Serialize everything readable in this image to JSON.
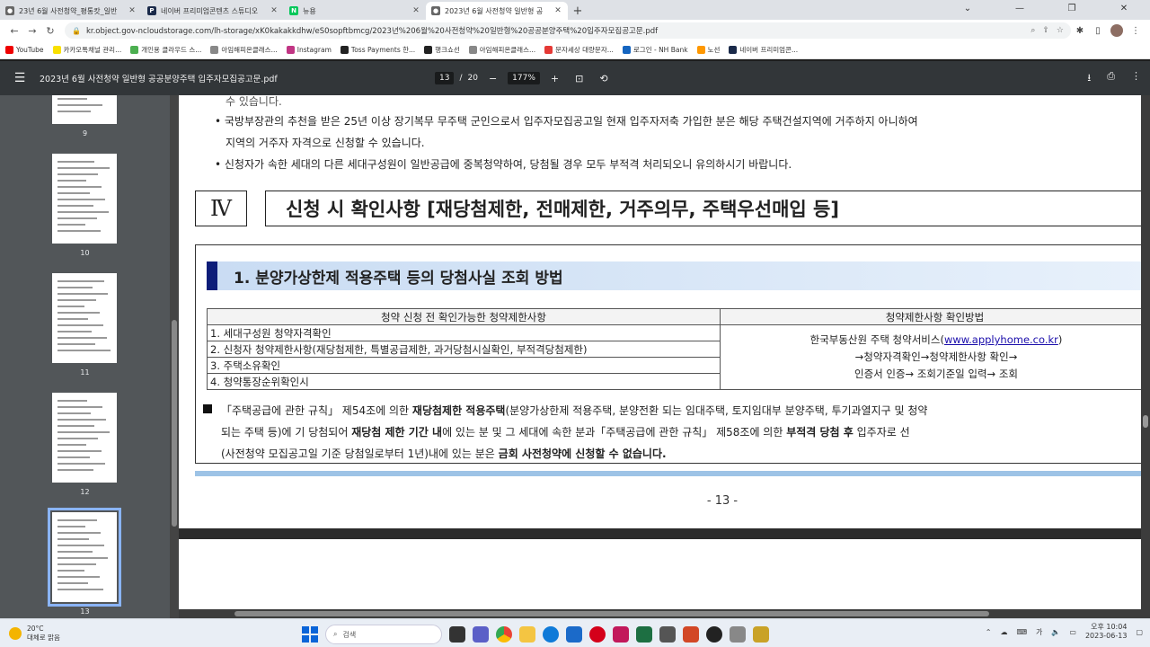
{
  "browser": {
    "tabs": [
      {
        "title": "23년 6월 사전청약_평통캇_일반",
        "color": "#555"
      },
      {
        "title": "네이버 프리미엄콘텐츠 스튜디오",
        "color": "#1a2a4a"
      },
      {
        "title": "뉴용",
        "color": "#03c75a"
      },
      {
        "title": "2023년 6월 사전청약 일반형 공",
        "color": "#555"
      }
    ],
    "url": "kr.object.gov-ncloudstorage.com/lh-storage/xK0kakakkdhw/eS0sopftbmcg/2023년%206월%20사전청약%20일반형%20공공분양주택%20입주자모집공고문.pdf",
    "bookmarks": [
      {
        "label": "YouTube",
        "color": "#e00"
      },
      {
        "label": "카카오톡채널 관리...",
        "color": "#f9e000"
      },
      {
        "label": "개인용 클라우드 스...",
        "color": "#4caf50"
      },
      {
        "label": "아임해피온클래스...",
        "color": "#888"
      },
      {
        "label": "Instagram",
        "color": "#c13584"
      },
      {
        "label": "Toss Payments 한...",
        "color": "#222"
      },
      {
        "label": "행크쇼선",
        "color": "#222"
      },
      {
        "label": "아임해피온클래스...",
        "color": "#888"
      },
      {
        "label": "문자세상 대량문자...",
        "color": "#e53935"
      },
      {
        "label": "로그인 - NH Bank",
        "color": "#1565c0"
      },
      {
        "label": "노선",
        "color": "#ff9800"
      },
      {
        "label": "네이버 프리미엄콘...",
        "color": "#1a2a4a"
      }
    ]
  },
  "pdf": {
    "title": "2023년 6월 사전청약 일반형 공공분양주택 입주자모집공고문.pdf",
    "page_current": "13",
    "page_sep": "/",
    "page_total": "20",
    "zoom": "177%",
    "thumbnails": [
      {
        "num": "9"
      },
      {
        "num": "10"
      },
      {
        "num": "11"
      },
      {
        "num": "12"
      },
      {
        "num": "13"
      }
    ],
    "top_text": {
      "line0": "수 있습니다.",
      "bullet1a": "• 국방부장관의 추천을 받은 25년 이상 장기복무 무주택 군인으로서 입주자모집공고일 현재 입주자저축 가입한 분은 해당 주택건설지역에 거주하지 아니하여",
      "bullet1b": "지역의 거주자 자격으로 신청할 수 있습니다.",
      "bullet2": "• 신청자가 속한 세대의 다른 세대구성원이 일반공급에 중복청약하여, 당첨될 경우 모두 부적격 처리되오니 유의하시기 바랍니다."
    },
    "section": {
      "roman": "Ⅳ",
      "title": "신청 시 확인사항 [재당첨제한, 전매제한, 거주의무, 주택우선매입 등]"
    },
    "subsection": {
      "title": "1. 분양가상한제 적용주택 등의 당첨사실 조회 방법",
      "table": {
        "headers": [
          "청약 신청 전 확인가능한 청약제한사항",
          "청약제한사항 확인방법"
        ],
        "rows": [
          "1. 세대구성원 청약자격확인",
          "2. 신청자 청약제한사항(재당첨제한, 특별공급제한, 과거당첨시실확인, 부적격당첨제한)",
          "3. 주택소유확인",
          "4. 청약통장순위확인시"
        ],
        "method_line1": "한국부동산원 주택 청약서비스(",
        "method_link": "www.applyhome.co.kr",
        "method_line1_end": ")",
        "method_line2": "→청약자격확인→청약제한사항 확인→",
        "method_line3": "인증서 인증→ 조회기준일 입력→ 조회"
      },
      "note": {
        "l1_a": "「주택공급에 관한 규칙」 제54조에 의한 ",
        "l1_b": "재당첨제한 적용주택",
        "l1_c": "(분양가상한제 적용주택, 분양전환 되는 임대주택, 토지임대부 분양주택, 투기과열지구 및 청약",
        "l2_a": "되는 주택 등)에 기 당첨되어 ",
        "l2_b": "재당첨 제한 기간 내",
        "l2_c": "에 있는 분 및 그 세대에 속한 분과「주택공급에 관한 규칙」 제58조에 의한 ",
        "l2_d": "부적격 당첨 후",
        "l2_e": " 입주자로 선",
        "l3_a": "(사전청약 모집공고일 기준 당첨일로부터 1년)내에 있는 분은 ",
        "l3_b": "금회 사전청약에 신청할 수 없습니다."
      }
    },
    "page_number": "- 13 -"
  },
  "taskbar": {
    "weather_temp": "20°C",
    "weather_desc": "대체로 맑음",
    "search_label": "검색",
    "time": "오후 10:04",
    "date": "2023-06-13",
    "lang": "가"
  }
}
